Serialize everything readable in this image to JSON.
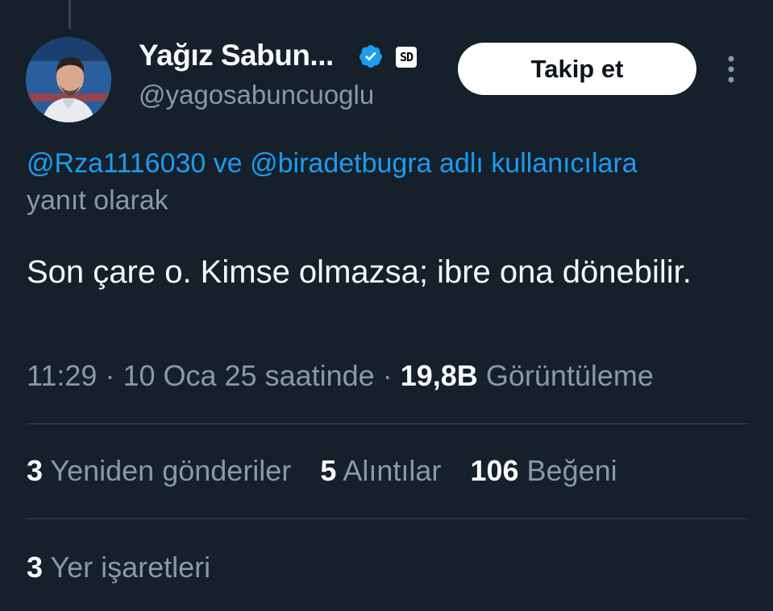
{
  "author": {
    "display_name": "Yağız Sabun...",
    "handle": "@yagosabuncuoglu",
    "affiliate_badge": "SD",
    "verified_icon": "verified-badge-icon",
    "avatar": "profile-photo"
  },
  "follow_button": {
    "label": "Takip et"
  },
  "more_icon": "more-vertical-icon",
  "reply_context": {
    "mention_1": "@Rza1116030",
    "connector": "ve",
    "mention_2": "@biradetbugra",
    "tail": "adlı kullanıcılara",
    "line2": "yanıt olarak"
  },
  "tweet": {
    "text": "Son çare o. Kimse olmazsa; ibre ona dönebilir."
  },
  "meta": {
    "time": "11:29",
    "sep1": "·",
    "date": "10 Oca 25 saatinde",
    "sep2": "·",
    "views_count": "19,8B",
    "views_label": "Görüntüleme"
  },
  "stats": {
    "reposts_count": "3",
    "reposts_label": "Yeniden gönderiler",
    "quotes_count": "5",
    "quotes_label": "Alıntılar",
    "likes_count": "106",
    "likes_label": "Beğeni"
  },
  "bookmarks": {
    "count": "3",
    "label": "Yer işaretleri"
  },
  "colors": {
    "background": "#15202b",
    "text_primary": "#f7f9f9",
    "text_secondary": "#8b98a5",
    "link": "#1d9bf0",
    "divider": "#38444d",
    "button_bg": "#ffffff"
  }
}
